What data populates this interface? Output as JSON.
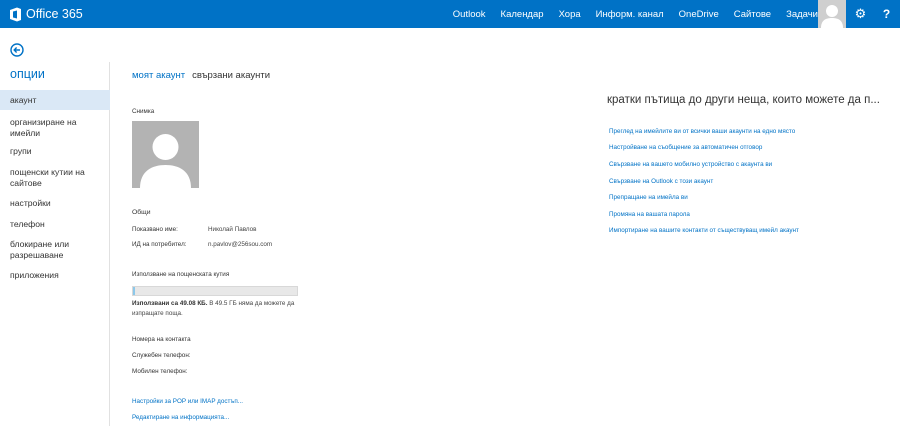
{
  "header": {
    "brand": "Office 365",
    "nav": [
      "Outlook",
      "Календар",
      "Хора",
      "Информ. канал",
      "OneDrive",
      "Сайтове",
      "Задачи"
    ],
    "settings_icon": "gear-icon",
    "help_label": "?",
    "accent": "#0072c6"
  },
  "sidebar": {
    "title": "опции",
    "items": [
      {
        "label": "акаунт",
        "active": true
      },
      {
        "label": "организиране на имейли"
      },
      {
        "label": "групи"
      },
      {
        "label": "пощенски кутии на сайтове"
      },
      {
        "label": "настройки"
      },
      {
        "label": "телефон"
      },
      {
        "label": "блокиране или разрешаване"
      },
      {
        "label": "приложения"
      }
    ]
  },
  "tabs": {
    "my_account": "моят акаунт",
    "connected": "свързани акаунти"
  },
  "account": {
    "photo_label": "Снимка",
    "general_label": "Общи",
    "display_name_label": "Показвано име:",
    "display_name": "Николай Павлов",
    "user_id_label": "ИД на потребител:",
    "user_id": "n.pavlov@256sou.com",
    "mailbox_usage_label": "Използване на пощенската кутия",
    "usage_percent": 1,
    "usage_bold": "Използвани са 49.08 КБ.",
    "usage_rest": " В 49.5 ГБ няма да можете да изпращате поща.",
    "contacts_label": "Номера на контакта",
    "work_phone_label": "Служебен телефон:",
    "mobile_phone_label": "Мобилен телефон:",
    "pop_imap_link": "Настройки за POP или IMAP достъп...",
    "edit_info_link": "Редактиране на информацията..."
  },
  "shortcuts": {
    "title": "кратки пътища до други неща, които можете да п...",
    "links": [
      "Преглед на имейлите ви от всички ваши акаунти на едно място",
      "Настройване на съобщение за автоматичен отговор",
      "Свързване на вашето мобилно устройство с акаунта ви",
      "Свързване на Outlook с този акаунт",
      "Препращане на имейла ви",
      "Промяна на вашата парола",
      "Импортиране на вашите контакти от съществуващ имейл акаунт"
    ]
  }
}
